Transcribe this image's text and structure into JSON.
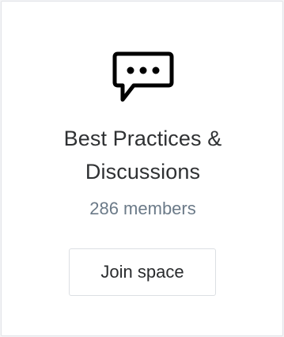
{
  "space_card": {
    "icon": "speech-bubble-icon",
    "title": "Best Practices &\nDiscussions",
    "members": "286 members",
    "join_label": "Join space"
  },
  "colors": {
    "title": "#2f3133",
    "members": "#6b7a88",
    "border": "#e2e4e8"
  }
}
